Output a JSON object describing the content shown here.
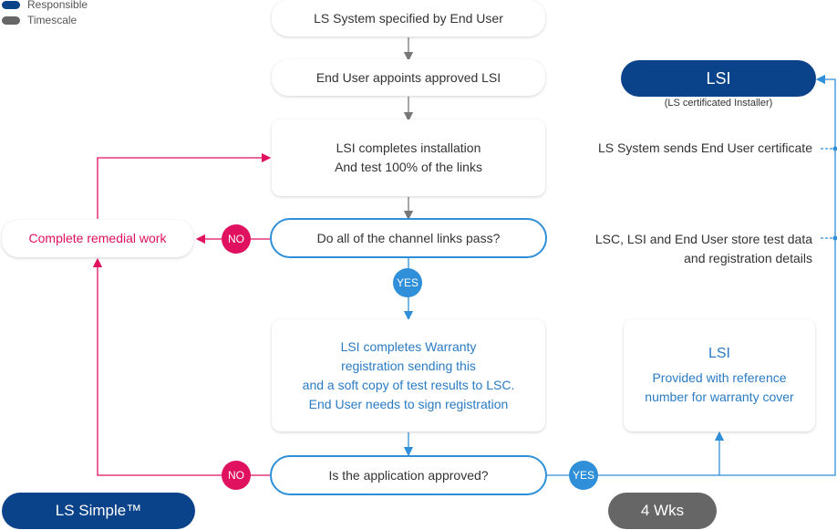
{
  "legend": [
    {
      "label": "Responsible",
      "color": "#0a4389"
    },
    {
      "label": "Timescale",
      "color": "#666666"
    }
  ],
  "colors": {
    "navy": "#0a4389",
    "grey": "#666666",
    "blue": "#2f8fd8",
    "magenta": "#e0115f",
    "text": "#333333"
  },
  "flow": {
    "step1": "LS System specified by End User",
    "step2": "End User appoints approved LSI",
    "step3_line1": "LSI completes installation",
    "step3_line2": "And test 100% of the links",
    "decision1": "Do all of the channel links pass?",
    "step4_lines": [
      "LSI completes Warranty",
      "registration sending this",
      "and a soft copy of test results to LSC.",
      "End User needs to sign registration"
    ],
    "decision2": "Is the application approved?",
    "remedial": "Complete remedial work",
    "no_label": "NO",
    "yes_label": "YES"
  },
  "right_panel": {
    "lsi_pill": "LSI",
    "lsi_subtitle": "(LS certificated Installer)",
    "note1": "LS System sends End User certificate",
    "note2_line1": "LSC, LSI and End User store test data",
    "note2_line2": "and registration details",
    "card_title": "LSI",
    "card_line1": "Provided with reference",
    "card_line2": "number for warranty cover"
  },
  "footer": {
    "responsible_pill": "LS Simple™",
    "timescale_pill": "4 Wks"
  }
}
